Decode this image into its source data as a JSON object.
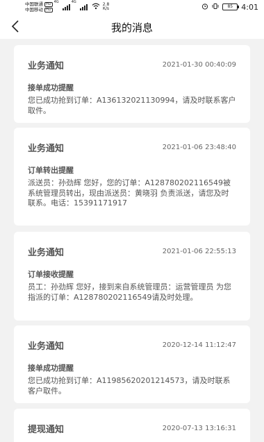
{
  "status_bar": {
    "carrier_1": "中国联通",
    "carrier_2": "中国移动",
    "hd_badge": "HD",
    "network_1": "4G",
    "network_2": "4G",
    "speed_value": "2.8",
    "speed_unit": "K/s",
    "battery": "85",
    "time": "4:01"
  },
  "header": {
    "title": "我的消息"
  },
  "messages": [
    {
      "category": "业务通知",
      "time": "2021-01-30 00:40:09",
      "title": "接单成功提醒",
      "body": "您已成功抢到订单：A136132021130994，请及时联系客户取件。"
    },
    {
      "category": "业务通知",
      "time": "2021-01-06 23:48:40",
      "title": "订单转出提醒",
      "body": "派送员：孙劲辉 您好，您的订单：A128780202116549被系统管理员转出，现由派送员：黄晓羽 负责派送，请您及时联系。电话：15391171917"
    },
    {
      "category": "业务通知",
      "time": "2021-01-06 22:55:13",
      "title": "订单接收提醒",
      "body": "员工：孙劲辉 您好，接到来自系统管理员：运营管理员 为您指派的订单：A128780202116549请及时处理。"
    },
    {
      "category": "业务通知",
      "time": "2020-12-14 11:12:47",
      "title": "接单成功提醒",
      "body": "您已成功抢到订单：A119856202012145​73，请及时联系客户取件。"
    },
    {
      "category": "提现通知",
      "time": "2020-07-13 13:16:31",
      "title": "",
      "body": ""
    }
  ]
}
